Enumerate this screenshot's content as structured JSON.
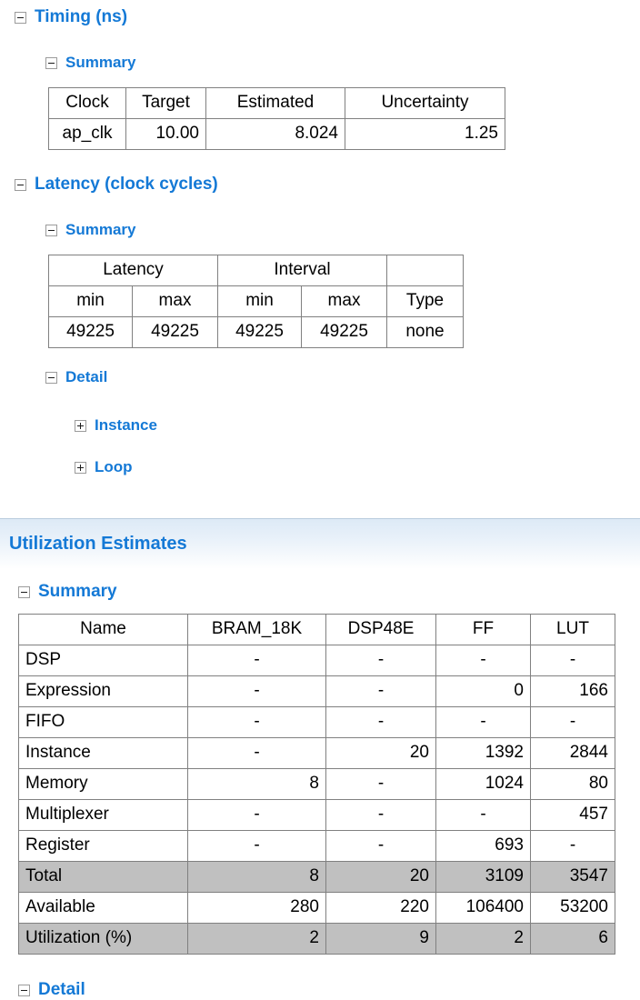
{
  "sections": [
    {
      "id": "timing",
      "title": "Timing (ns)",
      "expander": "minus",
      "summary_label": "Summary"
    },
    {
      "id": "latency",
      "title": "Latency (clock cycles)",
      "expander": "minus",
      "summary_label": "Summary",
      "detail_label": "Detail",
      "detail_children": [
        {
          "label": "Instance",
          "expander": "plus"
        },
        {
          "label": "Loop",
          "expander": "plus"
        }
      ]
    },
    {
      "id": "utilization",
      "title": "Utilization Estimates",
      "summary_label": "Summary",
      "detail_label": "Detail"
    }
  ],
  "timing_table": {
    "headers": [
      "Clock",
      "Target",
      "Estimated",
      "Uncertainty"
    ],
    "rows": [
      {
        "clock": "ap_clk",
        "target": "10.00",
        "estimated": "8.024",
        "uncertainty": "1.25"
      }
    ]
  },
  "latency_table": {
    "group_headers": [
      "Latency",
      "Interval",
      ""
    ],
    "sub_headers": [
      "min",
      "max",
      "min",
      "max",
      "Type"
    ],
    "rows": [
      {
        "latency_min": "49225",
        "latency_max": "49225",
        "interval_min": "49225",
        "interval_max": "49225",
        "type": "none"
      }
    ]
  },
  "utilization_table": {
    "headers": [
      "Name",
      "BRAM_18K",
      "DSP48E",
      "FF",
      "LUT"
    ],
    "rows": [
      {
        "name": "DSP",
        "bram": "-",
        "dsp": "-",
        "ff": "-",
        "lut": "-",
        "highlight": false
      },
      {
        "name": "Expression",
        "bram": "-",
        "dsp": "-",
        "ff": "0",
        "lut": "166",
        "highlight": false
      },
      {
        "name": "FIFO",
        "bram": "-",
        "dsp": "-",
        "ff": "-",
        "lut": "-",
        "highlight": false
      },
      {
        "name": "Instance",
        "bram": "-",
        "dsp": "20",
        "ff": "1392",
        "lut": "2844",
        "highlight": false
      },
      {
        "name": "Memory",
        "bram": "8",
        "dsp": "-",
        "ff": "1024",
        "lut": "80",
        "highlight": false
      },
      {
        "name": "Multiplexer",
        "bram": "-",
        "dsp": "-",
        "ff": "-",
        "lut": "457",
        "highlight": false
      },
      {
        "name": "Register",
        "bram": "-",
        "dsp": "-",
        "ff": "693",
        "lut": "-",
        "highlight": false
      },
      {
        "name": "Total",
        "bram": "8",
        "dsp": "20",
        "ff": "3109",
        "lut": "3547",
        "highlight": true
      },
      {
        "name": "Available",
        "bram": "280",
        "dsp": "220",
        "ff": "106400",
        "lut": "53200",
        "highlight": false
      },
      {
        "name": "Utilization (%)",
        "bram": "2",
        "dsp": "9",
        "ff": "2",
        "lut": "6",
        "highlight": true
      }
    ]
  },
  "colors": {
    "heading_blue": "#1479d6",
    "highlight_gray": "#c0c0c0",
    "table_border": "#808080",
    "banner_top": "#ddeaf6"
  }
}
